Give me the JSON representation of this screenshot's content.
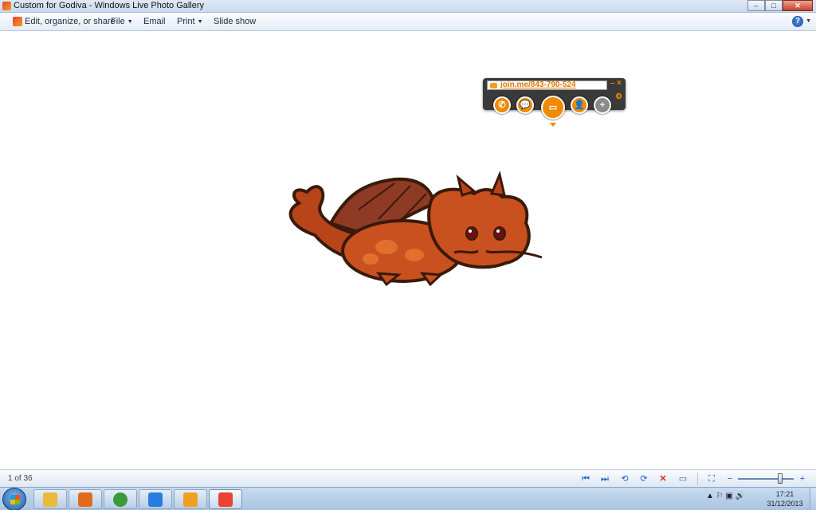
{
  "window": {
    "title": "Custom for Godiva - Windows Live Photo Gallery",
    "minimize_label": "–",
    "maximize_label": "□",
    "close_label": "✕"
  },
  "commandbar": {
    "edit_label": "Edit, organize, or share",
    "file_label": "File",
    "email_label": "Email",
    "print_label": "Print",
    "slideshow_label": "Slide show",
    "help_label": "?"
  },
  "joinme": {
    "url": "join.me/843-790-524",
    "minimize_label": "–",
    "close_label": "×",
    "buttons": [
      {
        "icon": "phone-icon",
        "glyph": "✆"
      },
      {
        "icon": "chat-icon",
        "glyph": "💬"
      },
      {
        "icon": "screen-share-icon",
        "glyph": "▭"
      },
      {
        "icon": "people-icon",
        "glyph": "👤"
      },
      {
        "icon": "add-icon",
        "glyph": "+"
      }
    ]
  },
  "status": {
    "count_text": "1 of 36"
  },
  "viewer_controls": {
    "first": "⏮",
    "next": "⏭",
    "rotate_left": "⟲",
    "rotate_right": "⟳",
    "delete": "✕",
    "slideshow": "▭",
    "fit": "⛶",
    "zoom_out": "−",
    "zoom_in": "+",
    "zoom_level": 0.75
  },
  "taskbar": {
    "apps": [
      {
        "name": "windows-explorer",
        "color": "#e8b93a"
      },
      {
        "name": "media-player",
        "color": "#e36b1d"
      },
      {
        "name": "chrome",
        "color": "#3a9a3a"
      },
      {
        "name": "color-app",
        "color": "#2a7de0"
      },
      {
        "name": "joinme",
        "color": "#f0a020"
      },
      {
        "name": "photo-gallery",
        "color": "#e8442f"
      }
    ],
    "tray_text": "▲  ⚐  ▣  🔊",
    "time": "17:21",
    "date": "31/12/2013"
  },
  "colors": {
    "accent": "#f08a00",
    "dragon": "#c0461c"
  }
}
